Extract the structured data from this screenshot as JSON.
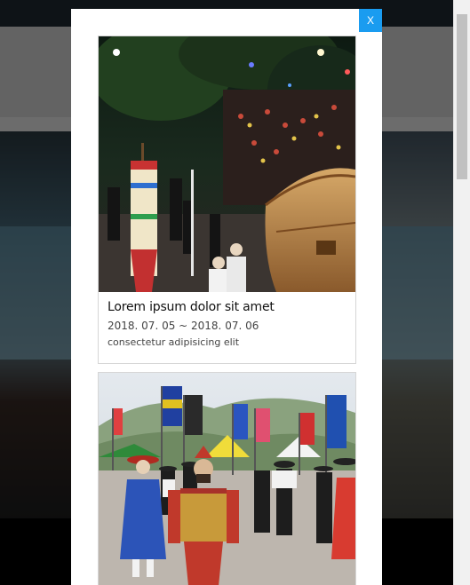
{
  "modal": {
    "close_label": "X",
    "cards": [
      {
        "title": "Lorem ipsum dolor sit amet",
        "date": "2018. 07. 05 ~ 2018. 07. 06",
        "description": "consectetur adipisicing elit"
      }
    ]
  },
  "colors": {
    "close_button": "#1a9cf0",
    "overlay": "rgba(0,0,0,0.55)"
  }
}
